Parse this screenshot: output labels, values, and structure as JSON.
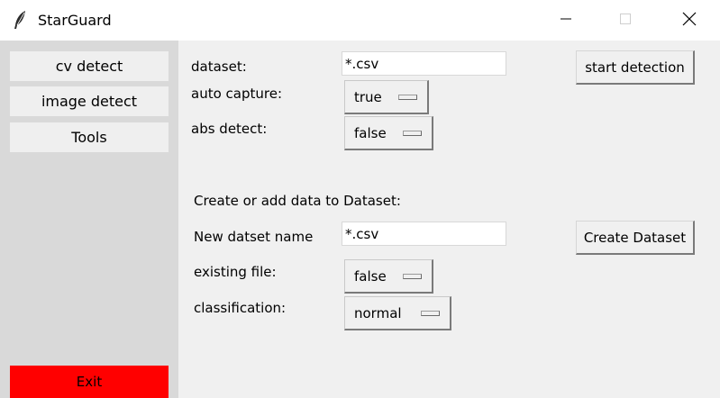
{
  "window": {
    "title": "StarGuard"
  },
  "sidebar": {
    "items": [
      {
        "label": "cv detect"
      },
      {
        "label": "image detect"
      },
      {
        "label": "Tools"
      }
    ],
    "exit_label": "Exit",
    "exit_color": "#ff0000"
  },
  "detection": {
    "dataset_label": "dataset:",
    "dataset_value": "*.csv",
    "auto_capture_label": "auto capture:",
    "auto_capture_value": "true",
    "abs_detect_label": "abs detect:",
    "abs_detect_value": "false",
    "start_button": "start detection"
  },
  "create": {
    "section_title": "Create or add data to Dataset:",
    "name_label": "New datset name",
    "name_value": "*.csv",
    "existing_label": "existing file:",
    "existing_value": "false",
    "classification_label": "classification:",
    "classification_value": "normal",
    "create_button": "Create Dataset"
  },
  "icons": {
    "app": "feather-icon",
    "minimize": "minimize-icon",
    "maximize": "maximize-icon",
    "close": "close-icon"
  }
}
